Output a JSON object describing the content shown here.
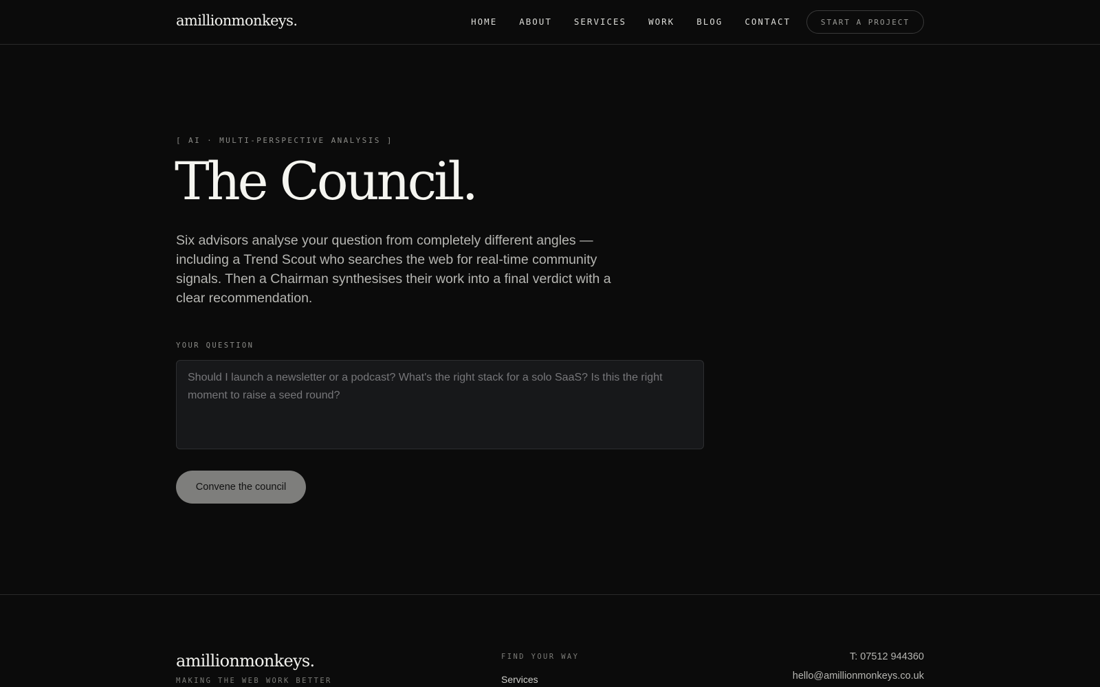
{
  "header": {
    "logo": "amillionmonkeys.",
    "nav": [
      {
        "label": "HOME"
      },
      {
        "label": "ABOUT"
      },
      {
        "label": "SERVICES"
      },
      {
        "label": "WORK"
      },
      {
        "label": "BLOG"
      },
      {
        "label": "CONTACT"
      }
    ],
    "cta_label": "START A PROJECT"
  },
  "hero": {
    "eyebrow": "[ AI · MULTI-PERSPECTIVE ANALYSIS ]",
    "title": "The Council.",
    "intro": "Six advisors analyse your question from completely different angles — including a Trend Scout who searches the web for real-time community signals. Then a Chairman synthesises their work into a final verdict with a clear recommendation."
  },
  "form": {
    "question_label": "YOUR QUESTION",
    "question_value": "",
    "question_placeholder": "Should I launch a newsletter or a podcast? What's the right stack for a solo SaaS? Is this the right moment to raise a seed round?",
    "submit_label": "Convene the council"
  },
  "footer": {
    "logo": "amillionmonkeys.",
    "tagline": "MAKING THE WEB WORK BETTER",
    "nav_heading": "FIND YOUR WAY",
    "links": [
      {
        "label": "Services"
      }
    ],
    "phone": "T: 07512 944360",
    "email": "hello@amillionmonkeys.co.uk"
  }
}
